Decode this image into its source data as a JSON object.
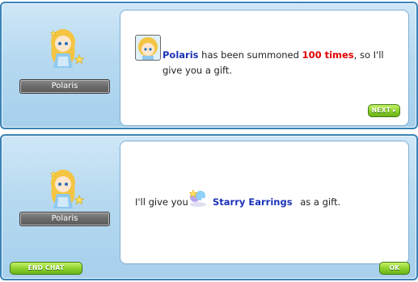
{
  "top": {
    "npc_name": "Polaris",
    "message": {
      "name": "Polaris",
      "part1": "has been summoned",
      "count": "100 times",
      "part2": ", so I'll",
      "line2": "give you a gift."
    },
    "next_label": "NEXT"
  },
  "bottom": {
    "npc_name": "Polaris",
    "message": {
      "prefix": "I'll give you",
      "item": "Starry Earrings",
      "suffix": "as a gift."
    },
    "end_chat_label": "END CHAT",
    "ok_label": "OK"
  },
  "colors": {
    "highlight_name": "#1c33b8",
    "highlight_count": "#e00000",
    "button_green": "#8fd22e",
    "frame_blue": "#3b83b6"
  },
  "icons": [
    "npc-polaris-sprite",
    "polaris-portrait-icon",
    "starry-earrings-icon",
    "next-arrow-icon"
  ]
}
